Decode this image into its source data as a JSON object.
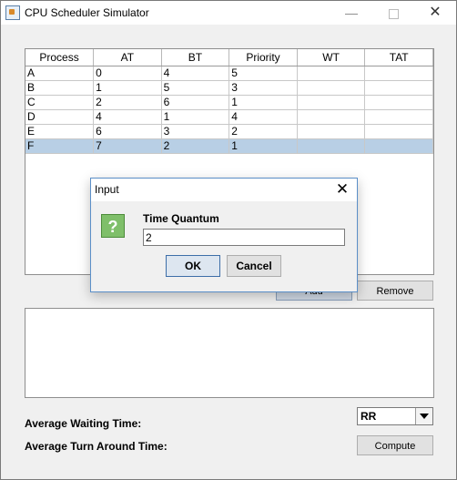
{
  "window": {
    "title": "CPU Scheduler Simulator"
  },
  "table": {
    "columns": [
      "Process",
      "AT",
      "BT",
      "Priority",
      "WT",
      "TAT"
    ],
    "rows": [
      [
        "A",
        "0",
        "4",
        "5",
        "",
        ""
      ],
      [
        "B",
        "1",
        "5",
        "3",
        "",
        ""
      ],
      [
        "C",
        "2",
        "6",
        "1",
        "",
        ""
      ],
      [
        "D",
        "4",
        "1",
        "4",
        "",
        ""
      ],
      [
        "E",
        "6",
        "3",
        "2",
        "",
        ""
      ],
      [
        "F",
        "7",
        "2",
        "1",
        "",
        ""
      ]
    ],
    "selected_row": 5
  },
  "buttons": {
    "add": "Add",
    "remove": "Remove",
    "compute": "Compute"
  },
  "labels": {
    "avg_wait": "Average Waiting Time:",
    "avg_tat": "Average Turn Around Time:"
  },
  "algorithm": {
    "selected": "RR"
  },
  "dialog": {
    "title": "Input",
    "prompt": "Time Quantum",
    "value": "2",
    "ok": "OK",
    "cancel": "Cancel"
  },
  "colors": {
    "selection": "#b8cfe5",
    "dialog_border": "#5b8fc8",
    "question_icon": "#7fbf6a"
  }
}
